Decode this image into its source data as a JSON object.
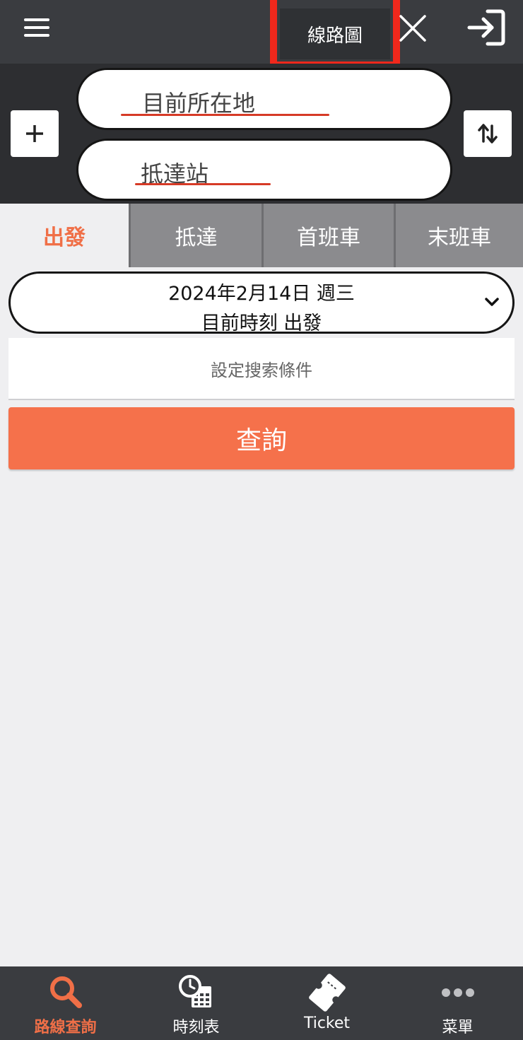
{
  "header": {
    "map_label": "線路圖",
    "icons": {
      "menu": "menu-icon",
      "close": "close-icon",
      "login": "login-icon"
    },
    "highlight_color": "#f0281c"
  },
  "stations": {
    "from_value": "目前所在地",
    "to_value": "抵達站",
    "add_symbol": "+",
    "underline_color": "#d63a26"
  },
  "tabs": [
    {
      "label": "出發",
      "active": true
    },
    {
      "label": "抵達",
      "active": false
    },
    {
      "label": "首班車",
      "active": false
    },
    {
      "label": "末班車",
      "active": false
    }
  ],
  "datetime": {
    "date": "2024年2月14日 週三",
    "time_mode": "目前時刻 出發"
  },
  "conditions_label": "設定搜索條件",
  "search_label": "查詢",
  "bottom_nav": [
    {
      "label": "路線查詢",
      "icon": "search-icon",
      "active": true
    },
    {
      "label": "時刻表",
      "icon": "timetable-icon",
      "active": false
    },
    {
      "label": "Ticket",
      "icon": "ticket-icon",
      "active": false
    },
    {
      "label": "菜單",
      "icon": "more-icon",
      "active": false
    }
  ],
  "colors": {
    "accent": "#f5714b",
    "header_bg": "#3a3c40",
    "tab_inactive": "#8b8b8e",
    "background": "#efeff1"
  }
}
